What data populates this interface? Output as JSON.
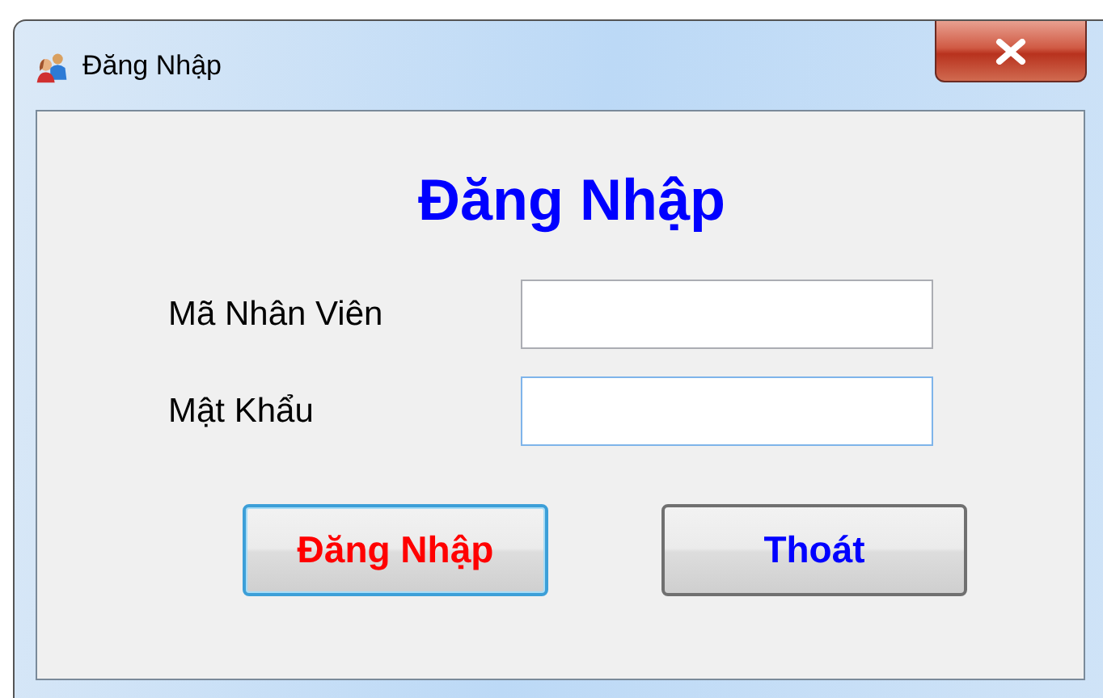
{
  "window": {
    "title": "Đăng Nhập"
  },
  "heading": "Đăng Nhập",
  "fields": [
    {
      "label": "Mã Nhân Viên",
      "focused": false
    },
    {
      "label": "Mật Khẩu",
      "focused": true
    }
  ],
  "buttons": [
    {
      "label": "Đăng Nhập",
      "kind": "primary",
      "focused": true
    },
    {
      "label": "Thoát",
      "kind": "secondary",
      "focused": false
    }
  ]
}
